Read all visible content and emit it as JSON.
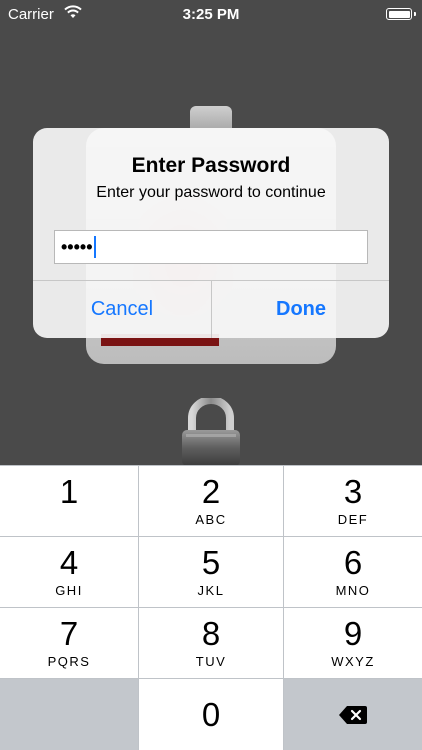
{
  "status_bar": {
    "carrier": "Carrier",
    "time": "3:25 PM"
  },
  "alert": {
    "title": "Enter Password",
    "message": "Enter your password to continue",
    "password_value": "•••••",
    "cancel_label": "Cancel",
    "done_label": "Done"
  },
  "keypad": {
    "keys": [
      {
        "num": "1",
        "letters": ""
      },
      {
        "num": "2",
        "letters": "ABC"
      },
      {
        "num": "3",
        "letters": "DEF"
      },
      {
        "num": "4",
        "letters": "GHI"
      },
      {
        "num": "5",
        "letters": "JKL"
      },
      {
        "num": "6",
        "letters": "MNO"
      },
      {
        "num": "7",
        "letters": "PQRS"
      },
      {
        "num": "8",
        "letters": "TUV"
      },
      {
        "num": "9",
        "letters": "WXYZ"
      },
      {
        "num": "0",
        "letters": ""
      }
    ],
    "delete_icon": "delete-backspace-icon"
  },
  "colors": {
    "accent": "#1577ff",
    "background": "#4a4a4a",
    "keypad_background": "#bfc3c8"
  }
}
